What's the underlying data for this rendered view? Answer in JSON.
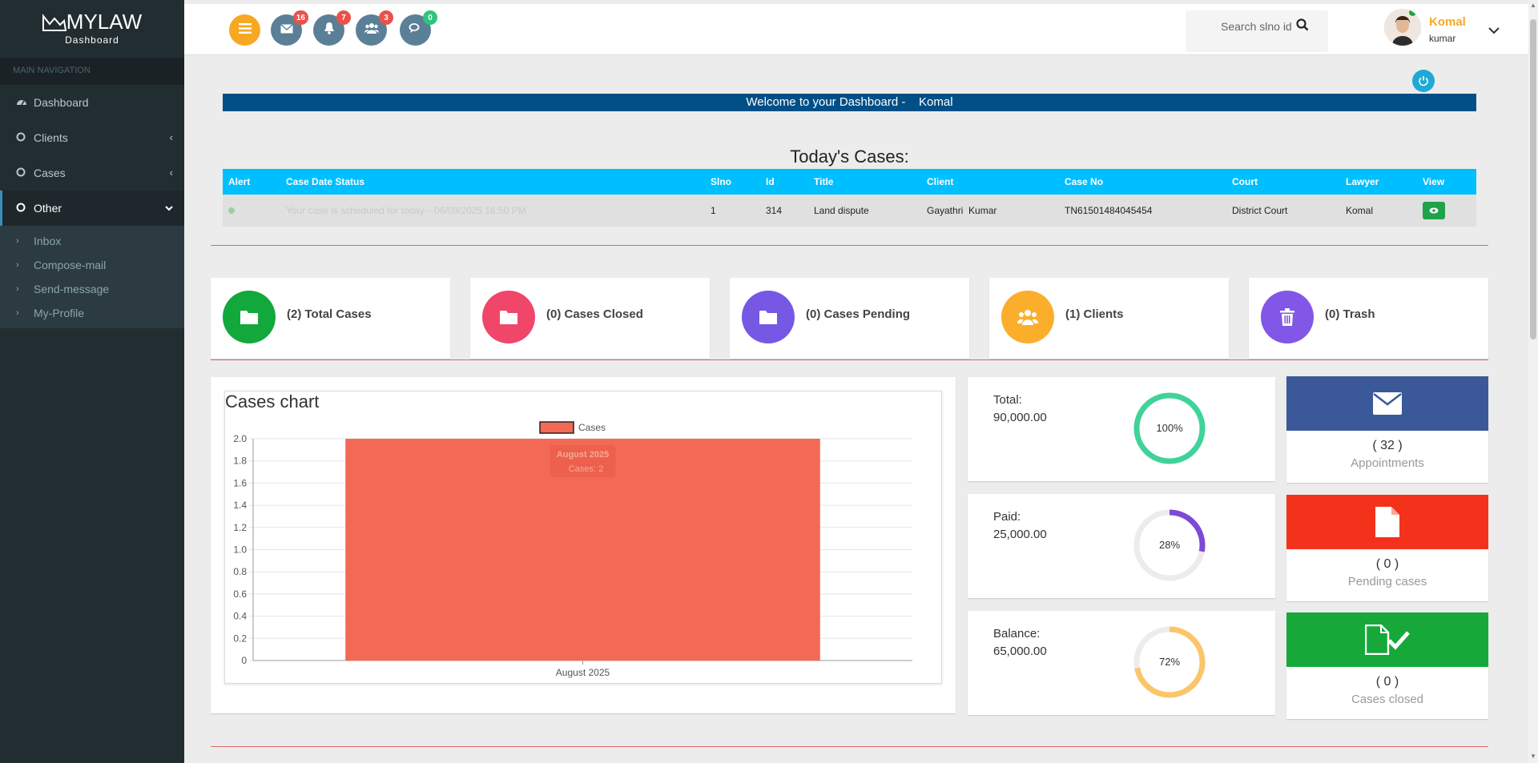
{
  "app": {
    "brand": "MYLAW",
    "brand_sub": "Dashboard"
  },
  "sidebar": {
    "heading": "MAIN NAVIGATION",
    "items": [
      {
        "label": "Dashboard",
        "icon": "dashboard-icon"
      },
      {
        "label": "Clients",
        "icon": "circle-icon",
        "arrow": "‹"
      },
      {
        "label": "Cases",
        "icon": "circle-icon",
        "arrow": "‹"
      },
      {
        "label": "Other",
        "icon": "circle-icon",
        "arrow": "⌄"
      }
    ],
    "subitems": [
      "Inbox",
      "Compose-mail",
      "Send-message",
      "My-Profile"
    ]
  },
  "topbar": {
    "badges": {
      "mail": "16",
      "bell": "7",
      "users": "3",
      "chat": "0"
    },
    "search_placeholder": "Search slno id",
    "user_name": "Komal",
    "user_role": "kumar"
  },
  "welcome": {
    "text": "Welcome to your Dashboard -    Komal"
  },
  "today": {
    "title": "Today's Cases:",
    "headers": [
      "Alert",
      "Case Date Status",
      "Slno",
      "Id",
      "Title",
      "Client",
      "Case No",
      "Court",
      "Lawyer",
      "View"
    ],
    "row": {
      "status": "Your case is scheduled for today---06/09/2025 16:50 PM",
      "slno": "1",
      "id": "314",
      "title": "Land dispute",
      "client": "Gayathri  Kumar",
      "case_no": "TN61501484045454",
      "court": "District Court",
      "lawyer": "Komal"
    }
  },
  "stats": [
    {
      "label": "(2) Total Cases",
      "color": "#12a83b",
      "icon": "folder-icon"
    },
    {
      "label": "(0) Cases Closed",
      "color": "#f0466a",
      "icon": "folder-icon"
    },
    {
      "label": "(0) Cases Pending",
      "color": "#7658e5",
      "icon": "folder-icon"
    },
    {
      "label": "(1) Clients",
      "color": "#fbae2c",
      "icon": "users-icon"
    },
    {
      "label": "(0) Trash",
      "color": "#8256e6",
      "icon": "trash-icon"
    }
  ],
  "finance": [
    {
      "label": "Total:",
      "value": "90,000.00",
      "percent_text": "100%",
      "percent": 100,
      "color": "#3fd39a"
    },
    {
      "label": "Paid:",
      "value": "25,000.00",
      "percent_text": "28%",
      "percent": 28,
      "color": "#7c4ad6"
    },
    {
      "label": "Balance:",
      "value": "65,000.00",
      "percent_text": "72%",
      "percent": 72,
      "color": "#fbc56a"
    }
  ],
  "boxes": [
    {
      "count": "( 32 )",
      "label": "Appointments",
      "color": "#3b5998",
      "icon": "envelope-icon"
    },
    {
      "count": "( 0 )",
      "label": "Pending cases",
      "color": "#f4321b",
      "icon": "file-icon"
    },
    {
      "count": "( 0 )",
      "label": "Cases closed",
      "color": "#16a93a",
      "icon": "file-check-icon"
    }
  ],
  "chart_data": {
    "type": "bar",
    "title": "Cases chart",
    "categories": [
      "August 2025"
    ],
    "series": [
      {
        "name": "Cases",
        "values": [
          2
        ]
      }
    ],
    "ylim": [
      0,
      2
    ],
    "yticks": [
      "0",
      "0.2",
      "0.4",
      "0.6",
      "0.8",
      "1.0",
      "1.2",
      "1.4",
      "1.6",
      "1.8",
      "2.0"
    ],
    "legend": "top-center",
    "bar_color": "#f26a55",
    "tooltip": {
      "title": "August 2025",
      "body": "Cases: 2"
    }
  }
}
